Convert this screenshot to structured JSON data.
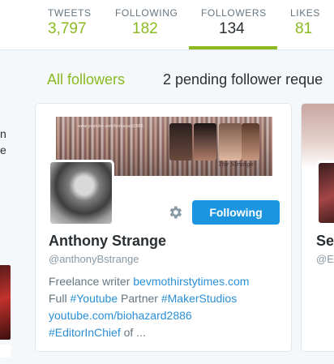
{
  "nav": {
    "stats": [
      {
        "label": "TWEETS",
        "value": "3,797"
      },
      {
        "label": "FOLLOWING",
        "value": "182"
      },
      {
        "label": "FOLLOWERS",
        "value": "134"
      },
      {
        "label": "LIKES",
        "value": "81"
      }
    ],
    "active_stat": "FOLLOWERS",
    "accent_color": "#8ab921"
  },
  "subtabs": {
    "all_followers": "All followers",
    "pending": "2 pending follower reque"
  },
  "left_partial": {
    "lines": [
      "n",
      "e"
    ]
  },
  "card": {
    "banner_url": "www.youtube.com/biohazard2886",
    "banner_signature": "The Strange",
    "name": "Anthony Strange",
    "handle": "@anthonyBstrange",
    "follow_button": "Following",
    "settings_icon": "gear-icon",
    "bio": {
      "line1_text": "Freelance writer ",
      "line1_link": "bevmothirstytimes.com",
      "line2_text_a": "Full ",
      "line2_link_a": "#Youtube",
      "line2_text_b": " Partner ",
      "line2_link_b": "#MakerStudios",
      "line3_link": "youtube.com/biohazard2886",
      "line4_link": "#EditorInChief",
      "line4_text": " of ..."
    }
  },
  "card_partial": {
    "name": "Se",
    "handle": "@E"
  },
  "colors": {
    "link": "#2a8fd6",
    "button": "#1b95e0"
  }
}
